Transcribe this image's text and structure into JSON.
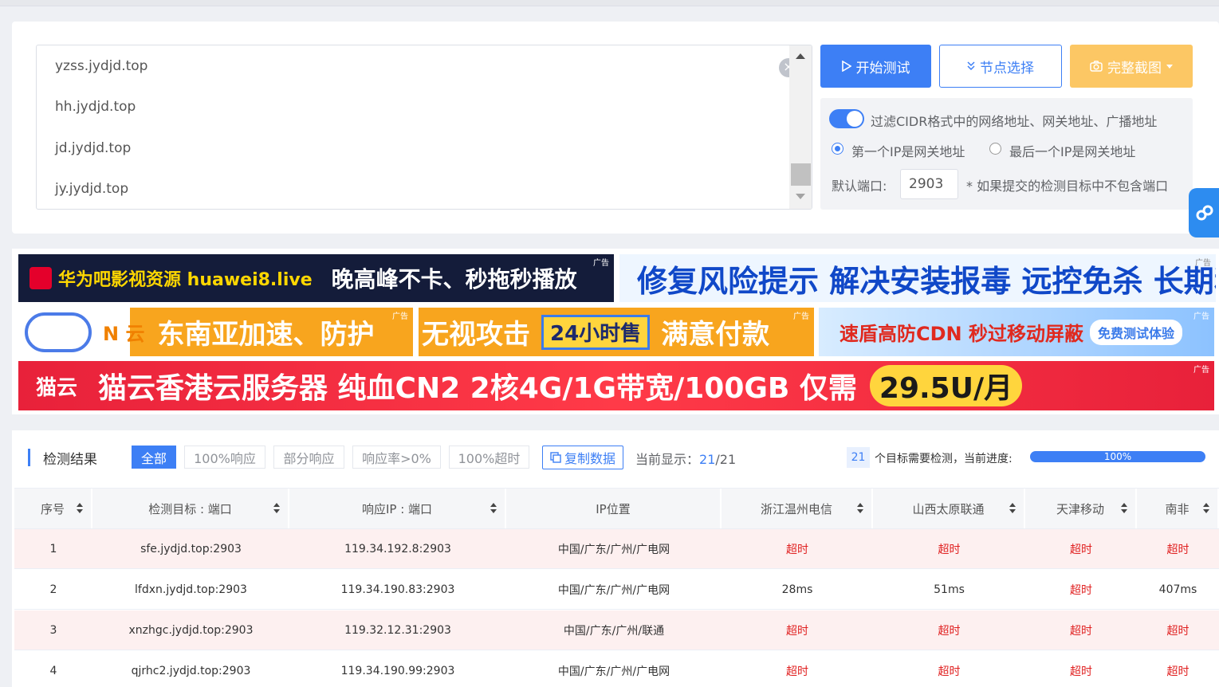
{
  "targets": [
    "yzss.jydjd.top",
    "hh.jydjd.top",
    "jd.jydjd.top",
    "jy.jydjd.top"
  ],
  "buttons": {
    "start": "开始测试",
    "nodes": "节点选择",
    "screenshot": "完整截图"
  },
  "options": {
    "filter_cidr": "过滤CIDR格式中的网络地址、网关地址、广播地址",
    "first_ip_gateway": "第一个IP是网关地址",
    "last_ip_gateway": "最后一个IP是网关地址",
    "default_port_label": "默认端口:",
    "default_port_value": "2903",
    "port_hint": "* 如果提交的检测目标中不包含端口"
  },
  "ads": {
    "tag": "广告",
    "ad1_brand": "华为吧影视资源 huawei8.live",
    "ad1_slogan": "晚高峰不卡、秒拖秒播放",
    "ad2_text": "修复风险提示 解决安装报毒 远控免杀 长期稳定",
    "ad3_n": "N 云",
    "ad3_text": "东南亚加速、防护",
    "ad4_a": "无视攻击",
    "ad4_box": "24小时售",
    "ad4_b": "满意付款",
    "ad5_text": "速盾高防CDN 秒过移动屏蔽",
    "ad5_pill": "免费测试体验",
    "ad6_brand": "猫云",
    "ad6_text": "猫云香港云服务器 纯血CN2 2核4G/1G带宽/100GB 仅需",
    "ad6_price": "29.5U/月"
  },
  "results": {
    "title": "检测结果",
    "filters": [
      "全部",
      "100%响应",
      "部分响应",
      "响应率>0%",
      "100%超时"
    ],
    "copy": "复制数据",
    "current_label": "当前显示：",
    "current_shown": "21",
    "current_total": "/21",
    "target_count": "21",
    "progress_label": "个目标需要检测，当前进度:",
    "progress": "100%",
    "progress_fraction": 1.0
  },
  "table": {
    "headers": [
      "序号",
      "检测目标 : 端口",
      "响应IP : 端口",
      "IP位置",
      "浙江温州电信",
      "山西太原联通",
      "天津移动",
      "南非"
    ],
    "rows": [
      [
        "1",
        "sfe.jydjd.top:2903",
        "119.34.192.8:2903",
        "中国/广东/广州/广电网",
        "超时",
        "超时",
        "超时",
        "超时"
      ],
      [
        "2",
        "lfdxn.jydjd.top:2903",
        "119.34.190.83:2903",
        "中国/广东/广州/广电网",
        "28ms",
        "51ms",
        "超时",
        "407ms"
      ],
      [
        "3",
        "xnzhgc.jydjd.top:2903",
        "119.32.12.31:2903",
        "中国/广东/广州/联通",
        "超时",
        "超时",
        "超时",
        "超时"
      ],
      [
        "4",
        "qjrhc2.jydjd.top:2903",
        "119.34.190.99:2903",
        "中国/广东/广州/广电网",
        "超时",
        "超时",
        "超时",
        "超时"
      ]
    ]
  },
  "colors": {
    "primary": "#3d7ff5",
    "warning": "#fcc764",
    "timeout": "#e02020"
  }
}
